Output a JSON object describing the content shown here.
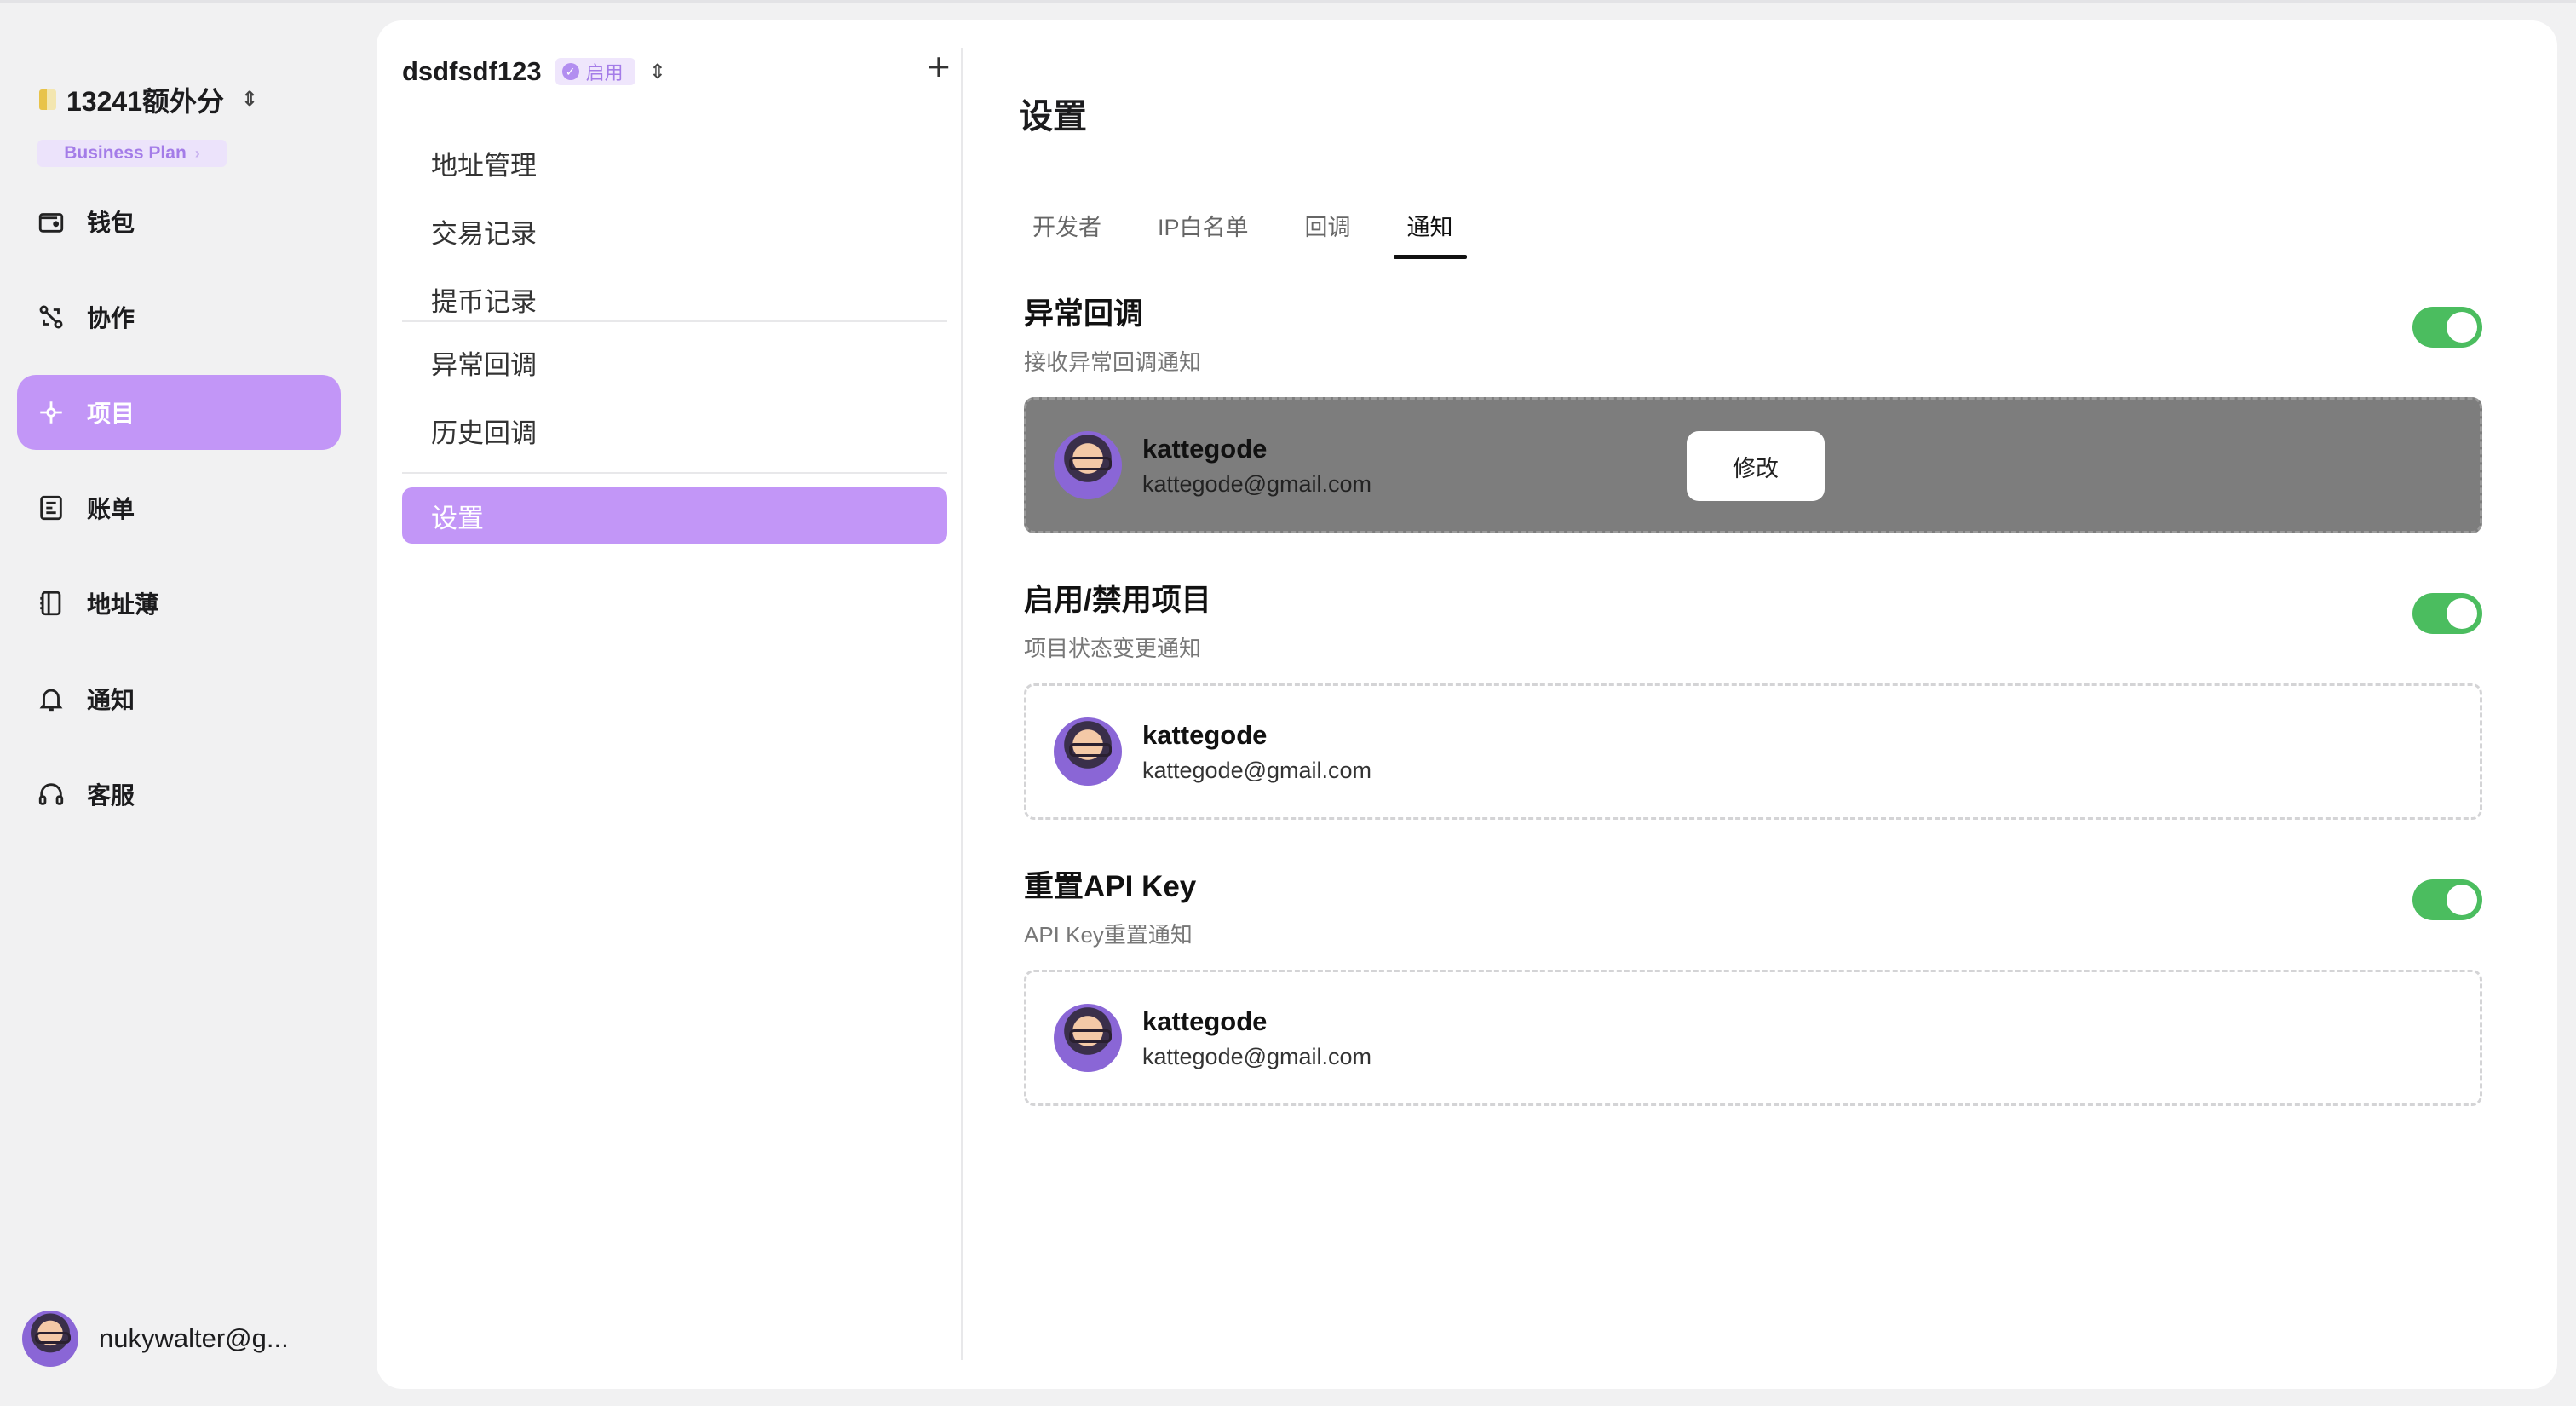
{
  "org": {
    "name": "13241额外分",
    "plan": "Business Plan"
  },
  "nav": [
    {
      "label": "钱包",
      "icon": "wallet-icon"
    },
    {
      "label": "协作",
      "icon": "collaboration-icon"
    },
    {
      "label": "项目",
      "icon": "project-icon",
      "active": true
    },
    {
      "label": "账单",
      "icon": "bill-icon"
    },
    {
      "label": "地址薄",
      "icon": "address-book-icon"
    },
    {
      "label": "通知",
      "icon": "bell-icon"
    },
    {
      "label": "客服",
      "icon": "headset-icon"
    }
  ],
  "user": {
    "email": "nukywalter@g..."
  },
  "project": {
    "name": "dsdfsdf123",
    "status": "启用",
    "menu": [
      "地址管理",
      "交易记录",
      "提币记录",
      "异常回调",
      "历史回调",
      "设置"
    ]
  },
  "settings": {
    "title": "设置",
    "tabs": [
      "开发者",
      "IP白名单",
      "回调",
      "通知"
    ],
    "active_tab": "通知",
    "edit_label": "修改",
    "sections": [
      {
        "title": "异常回调",
        "subtitle": "接收异常回调通知",
        "enabled": true,
        "contact": {
          "name": "kattegode",
          "email": "kattegode@gmail.com"
        }
      },
      {
        "title": "启用/禁用项目",
        "subtitle": "项目状态变更通知",
        "enabled": true,
        "contact": {
          "name": "kattegode",
          "email": "kattegode@gmail.com"
        }
      },
      {
        "title": "重置API Key",
        "subtitle": "API Key重置通知",
        "enabled": true,
        "contact": {
          "name": "kattegode",
          "email": "kattegode@gmail.com"
        }
      }
    ]
  }
}
